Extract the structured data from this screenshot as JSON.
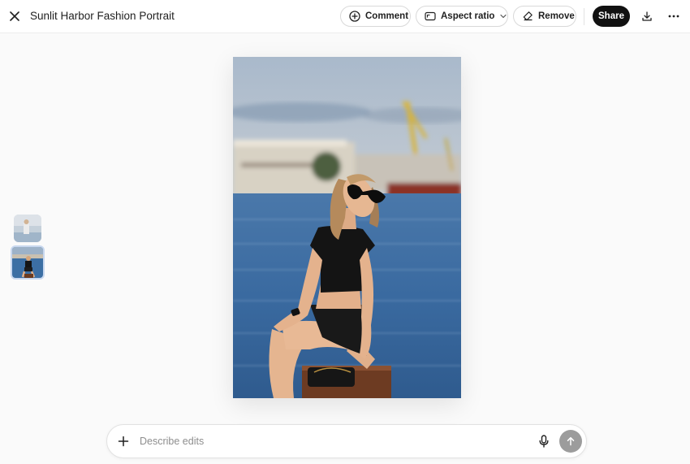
{
  "header": {
    "title": "Sunlit Harbor Fashion Portrait",
    "close_icon": "close-icon",
    "buttons": {
      "comment_label": "Comment",
      "aspect_ratio_label": "Aspect ratio",
      "remove_label": "Remove",
      "share_label": "Share"
    },
    "icons": [
      "comment-plus-icon",
      "aspect-ratio-icon",
      "chevron-down-icon",
      "eraser-icon",
      "download-icon",
      "more-icon"
    ]
  },
  "thumbnails": [
    {
      "name": "thumbnail-1",
      "selected": false
    },
    {
      "name": "thumbnail-2",
      "selected": true
    }
  ],
  "prompt": {
    "placeholder": "Describe edits",
    "value": "",
    "icons": [
      "plus-icon",
      "mic-icon",
      "send-arrow-icon"
    ]
  },
  "colors": {
    "share_bg": "#111111",
    "send_bg": "#9c9c9c",
    "page_bg": "#fafafa",
    "water": "#3d6ea3"
  }
}
